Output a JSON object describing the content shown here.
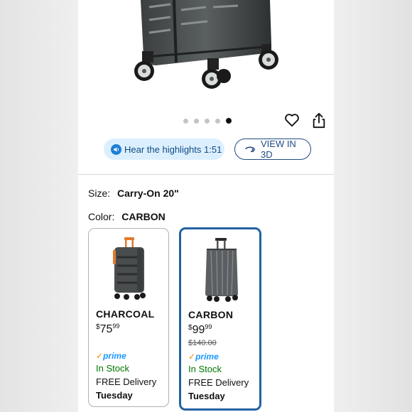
{
  "gallery": {
    "dots": 5,
    "active_dot": 4
  },
  "actions": {
    "highlights_label": "Hear the highlights 1:51",
    "view3d_label": "VIEW IN 3D"
  },
  "size": {
    "label": "Size:",
    "value": "Carry-On 20\""
  },
  "color": {
    "label": "Color:",
    "value": "CARBON"
  },
  "swatches": [
    {
      "name": "CHARCOAL",
      "price_whole": "75",
      "price_fraction": "99",
      "prime": "prime",
      "stock": "In Stock",
      "delivery": "FREE Delivery",
      "day": "Tuesday"
    },
    {
      "name": "CARBON",
      "price_whole": "99",
      "price_fraction": "99",
      "list_price": "$140.00",
      "prime": "prime",
      "stock": "In Stock",
      "delivery": "FREE Delivery",
      "day": "Tuesday"
    }
  ],
  "colors": {
    "accent_blue": "#2162a1",
    "highlight_bg": "#dcefff",
    "in_stock_green": "#007600",
    "prime_blue": "#1a98ff"
  }
}
